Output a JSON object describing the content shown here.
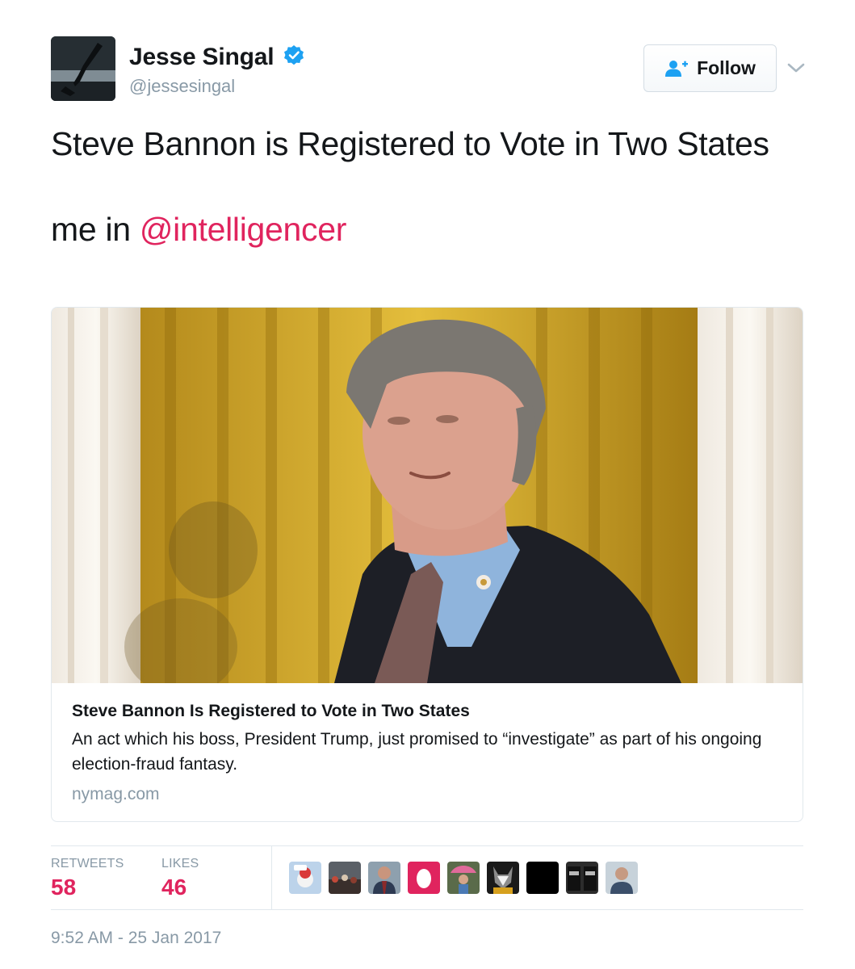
{
  "user": {
    "display_name": "Jesse Singal",
    "handle": "@jessesingal",
    "verified": true,
    "avatar_icon": "avatar-image"
  },
  "follow_button": {
    "label": "Follow",
    "icon": "follow-user-plus-icon"
  },
  "tweet": {
    "line1": "Steve Bannon is Registered to Vote in Two States",
    "line2_prefix": "me in ",
    "mention": "@intelligencer"
  },
  "card": {
    "title": "Steve Bannon Is Registered to Vote in Two States",
    "description": "An act which his boss, President Trump, just promised to “investigate” as part of his ongoing election-fraud fantasy.",
    "domain": "nymag.com"
  },
  "stats": {
    "retweets_label": "RETWEETS",
    "retweets_value": "58",
    "likes_label": "LIKES",
    "likes_value": "46"
  },
  "timestamp": "9:52 AM - 25 Jan 2017",
  "colors": {
    "accent": "#e0245e",
    "verified_blue": "#1da1f2",
    "muted": "#8899a6"
  }
}
